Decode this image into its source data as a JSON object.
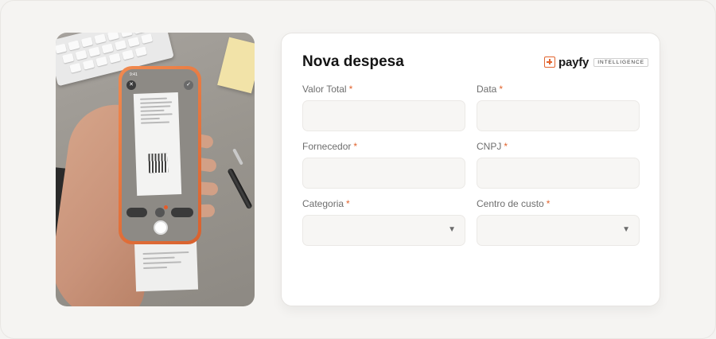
{
  "form": {
    "title": "Nova despesa",
    "required_mark": "*",
    "fields": [
      {
        "label": "Valor Total",
        "value": ""
      },
      {
        "label": "Data",
        "value": ""
      },
      {
        "label": "Fornecedor",
        "value": ""
      },
      {
        "label": "CNPJ",
        "value": ""
      },
      {
        "label": "Categoria",
        "value": ""
      },
      {
        "label": "Centro de custo",
        "value": ""
      }
    ],
    "dropdown_icon": "▼"
  },
  "brand": {
    "name": "payfy",
    "tag": "INTELLIGENCE",
    "accent": "#e2642e",
    "icon": "plus-box-icon"
  },
  "photo": {
    "description_icons": [
      "close-icon",
      "check-icon",
      "gallery-icon",
      "shutter-button"
    ]
  }
}
